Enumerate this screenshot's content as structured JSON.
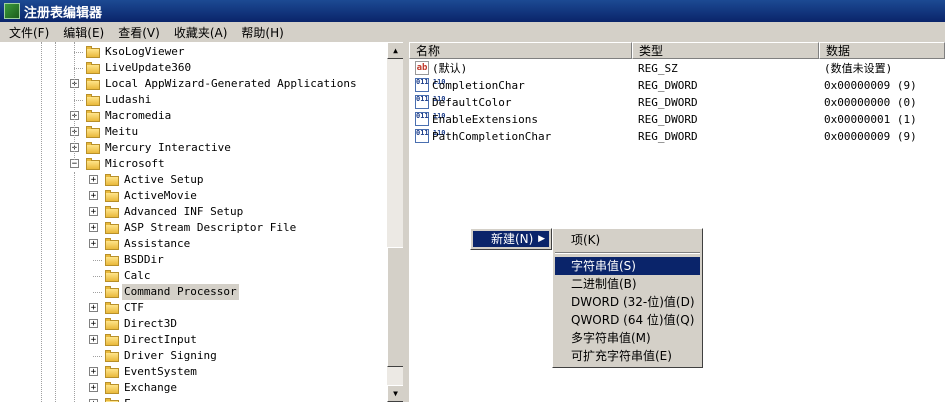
{
  "window": {
    "title": "注册表编辑器"
  },
  "menubar": [
    "文件(F)",
    "编辑(E)",
    "查看(V)",
    "收藏夹(A)",
    "帮助(H)"
  ],
  "tree": [
    {
      "label": "KsoLogViewer",
      "level": 0,
      "expander": ""
    },
    {
      "label": "LiveUpdate360",
      "level": 0,
      "expander": ""
    },
    {
      "label": "Local AppWizard-Generated Applications",
      "level": 0,
      "expander": "+"
    },
    {
      "label": "Ludashi",
      "level": 0,
      "expander": ""
    },
    {
      "label": "Macromedia",
      "level": 0,
      "expander": "+"
    },
    {
      "label": "Meitu",
      "level": 0,
      "expander": "+"
    },
    {
      "label": "Mercury Interactive",
      "level": 0,
      "expander": "+"
    },
    {
      "label": "Microsoft",
      "level": 0,
      "expander": "−"
    },
    {
      "label": "Active Setup",
      "level": 1,
      "expander": "+"
    },
    {
      "label": "ActiveMovie",
      "level": 1,
      "expander": "+"
    },
    {
      "label": "Advanced INF Setup",
      "level": 1,
      "expander": "+"
    },
    {
      "label": "ASP Stream Descriptor File",
      "level": 1,
      "expander": "+"
    },
    {
      "label": "Assistance",
      "level": 1,
      "expander": "+"
    },
    {
      "label": "BSDDir",
      "level": 1,
      "expander": ""
    },
    {
      "label": "Calc",
      "level": 1,
      "expander": ""
    },
    {
      "label": "Command Processor",
      "level": 1,
      "expander": "",
      "selected": true
    },
    {
      "label": "CTF",
      "level": 1,
      "expander": "+"
    },
    {
      "label": "Direct3D",
      "level": 1,
      "expander": "+"
    },
    {
      "label": "DirectInput",
      "level": 1,
      "expander": "+"
    },
    {
      "label": "Driver Signing",
      "level": 1,
      "expander": ""
    },
    {
      "label": "EventSystem",
      "level": 1,
      "expander": "+"
    },
    {
      "label": "Exchange",
      "level": 1,
      "expander": "+"
    },
    {
      "label": "F...",
      "level": 1,
      "expander": "+"
    }
  ],
  "list": {
    "columns": [
      "名称",
      "类型",
      "数据"
    ],
    "rows": [
      {
        "icon": "string-value-icon",
        "name": "(默认)",
        "type": "REG_SZ",
        "data": "(数值未设置)"
      },
      {
        "icon": "binary-value-icon",
        "name": "CompletionChar",
        "type": "REG_DWORD",
        "data": "0x00000009 (9)"
      },
      {
        "icon": "binary-value-icon",
        "name": "DefaultColor",
        "type": "REG_DWORD",
        "data": "0x00000000 (0)"
      },
      {
        "icon": "binary-value-icon",
        "name": "EnableExtensions",
        "type": "REG_DWORD",
        "data": "0x00000001 (1)"
      },
      {
        "icon": "binary-value-icon",
        "name": "PathCompletionChar",
        "type": "REG_DWORD",
        "data": "0x00000009 (9)"
      }
    ]
  },
  "context_menu": {
    "new_label": "新建(N)",
    "arrow": "▶"
  },
  "submenu": {
    "items": [
      {
        "label": "项(K)",
        "highlighted": false
      },
      {
        "label": "字符串值(S)",
        "highlighted": true
      },
      {
        "label": "二进制值(B)",
        "highlighted": false
      },
      {
        "label": "DWORD (32-位)值(D)",
        "highlighted": false
      },
      {
        "label": "QWORD (64 位)值(Q)",
        "highlighted": false
      },
      {
        "label": "多字符串值(M)",
        "highlighted": false
      },
      {
        "label": "可扩充字符串值(E)",
        "highlighted": false
      }
    ]
  },
  "colors": {
    "selection": "#0a246a",
    "title_bar": "#0a246a",
    "chrome": "#d4d0c8"
  }
}
